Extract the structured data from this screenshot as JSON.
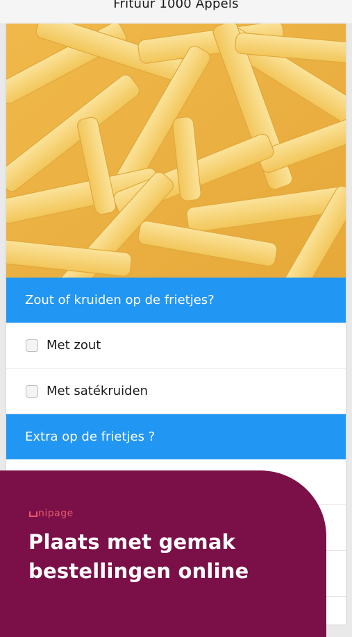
{
  "window": {
    "title": "Frituur 1000 Appels"
  },
  "product": {
    "image_icon": "fries-photo",
    "sections": [
      {
        "title": "Zout of kruiden op de frietjes?",
        "options": [
          {
            "label": "Met zout",
            "checked": false
          },
          {
            "label": "Met satékruiden",
            "checked": false
          }
        ]
      },
      {
        "title": "Extra op de frietjes ?"
      }
    ]
  },
  "promo": {
    "brand": "nipage",
    "line1": "Plaats met gemak",
    "line2": "bestellingen online",
    "background": "#7b1048",
    "accent": "#e85a6a"
  },
  "colors": {
    "section_header": "#2196f3"
  }
}
